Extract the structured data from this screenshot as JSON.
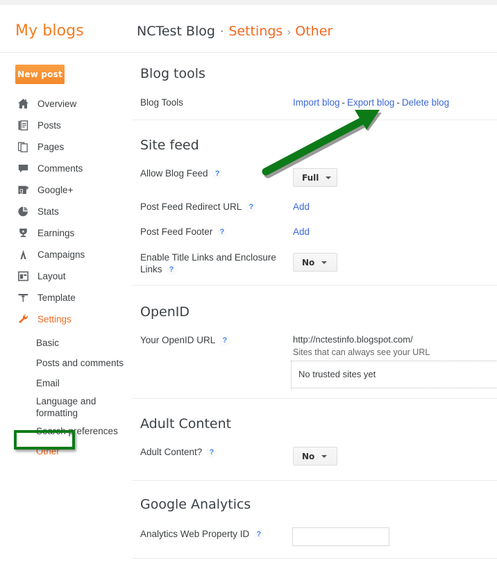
{
  "header": {
    "my_blogs_label": "My blogs",
    "blog_name": "NCTest Blog",
    "separator_dot": "·",
    "settings_crumb": "Settings",
    "separator_chevron": "›",
    "current_crumb": "Other"
  },
  "sidebar": {
    "new_post_label": "New post",
    "items": [
      {
        "label": "Overview",
        "icon": "home-icon"
      },
      {
        "label": "Posts",
        "icon": "posts-icon"
      },
      {
        "label": "Pages",
        "icon": "pages-icon"
      },
      {
        "label": "Comments",
        "icon": "comments-icon"
      },
      {
        "label": "Google+",
        "icon": "google-plus-icon"
      },
      {
        "label": "Stats",
        "icon": "stats-pie-icon"
      },
      {
        "label": "Earnings",
        "icon": "trophy-icon"
      },
      {
        "label": "Campaigns",
        "icon": "campaigns-icon"
      },
      {
        "label": "Layout",
        "icon": "layout-icon"
      },
      {
        "label": "Template",
        "icon": "template-brush-icon"
      },
      {
        "label": "Settings",
        "icon": "wrench-icon"
      }
    ],
    "sub_items": [
      {
        "label": "Basic"
      },
      {
        "label": "Posts and comments"
      },
      {
        "label": "Email"
      },
      {
        "label": "Language and formatting"
      },
      {
        "label": "Search preferences"
      },
      {
        "label": "Other"
      }
    ]
  },
  "content": {
    "blog_tools": {
      "title": "Blog tools",
      "row_label": "Blog Tools",
      "import_link": "Import blog",
      "export_link": "Export blog",
      "delete_link": "Delete blog",
      "separator": "-"
    },
    "site_feed": {
      "title": "Site feed",
      "allow_blog_feed_label": "Allow Blog Feed",
      "allow_blog_feed_value": "Full",
      "post_feed_redirect_label": "Post Feed Redirect URL",
      "post_feed_redirect_action": "Add",
      "post_feed_footer_label": "Post Feed Footer",
      "post_feed_footer_action": "Add",
      "enable_title_links_label": "Enable Title Links and Enclosure Links",
      "enable_title_links_value": "No"
    },
    "openid": {
      "title": "OpenID",
      "url_label": "Your OpenID URL",
      "url_value": "http://nctestinfo.blogspot.com/",
      "trusted_note": "Sites that can always see your URL",
      "trusted_empty": "No trusted sites yet"
    },
    "adult_content": {
      "title": "Adult Content",
      "row_label": "Adult Content?",
      "value": "No"
    },
    "google_analytics": {
      "title": "Google Analytics",
      "row_label": "Analytics Web Property ID",
      "input_value": "",
      "input_placeholder": ""
    },
    "help_glyph": "?"
  },
  "annotations": {
    "arrow_color": "#0d7a18",
    "box_color": "#0d7a18",
    "arrow_points_at": "Export blog",
    "box_around": "Other"
  },
  "colors": {
    "accent_orange": "#f3681f",
    "link_blue": "#3b68d8",
    "text_dark": "#3c4043",
    "annotation_green": "#0d7a18"
  }
}
